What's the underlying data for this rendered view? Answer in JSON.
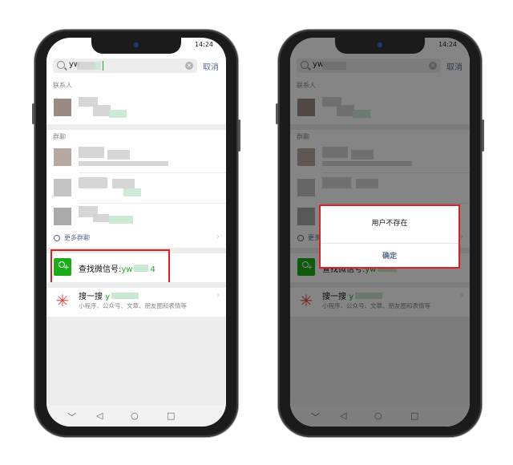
{
  "status": {
    "time": "14:24"
  },
  "search": {
    "query_left": "yw",
    "query_right": "yw",
    "cancel": "取消"
  },
  "sections": {
    "contacts": "联系人",
    "groups": "群聊",
    "more_groups": "更多群聊"
  },
  "find": {
    "prefix": "查找微信号:",
    "id_left": "yw",
    "id_right": "yw",
    "id_tail": "4"
  },
  "sousou": {
    "title": "搜一搜",
    "query": "y",
    "subtitle": "小程序、公众号、文章、朋友圈和表情等"
  },
  "dialog": {
    "message": "用户不存在",
    "confirm": "确定"
  },
  "nav": {
    "back": "◁",
    "home": "○",
    "recent": "□",
    "down": "﹀"
  },
  "colors": {
    "wechat_green": "#1aad19",
    "link_blue": "#576b95",
    "highlight_red": "#e02020",
    "sousou_red": "#e64340"
  }
}
